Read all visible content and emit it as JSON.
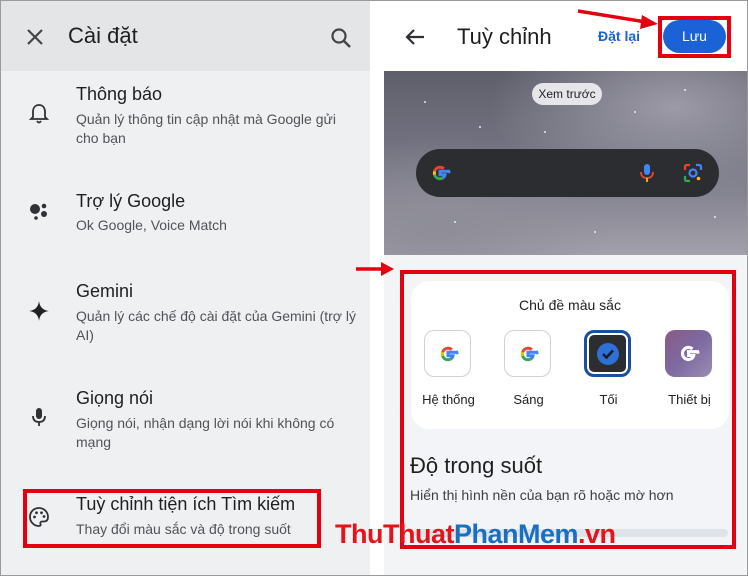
{
  "settings": {
    "title": "Cài đặt",
    "items": [
      {
        "icon": "bell-icon",
        "title": "Thông báo",
        "desc": "Quản lý thông tin cập nhật mà Google gửi cho bạn"
      },
      {
        "icon": "assistant-icon",
        "title": "Trợ lý Google",
        "desc": "Ok Google, Voice Match"
      },
      {
        "icon": "sparkle-icon",
        "title": "Gemini",
        "desc": "Quản lý các chế độ cài đặt của Gemini (trợ lý AI)"
      },
      {
        "icon": "microphone-icon",
        "title": "Giọng nói",
        "desc": "Giọng nói, nhận dạng lời nói khi không có mạng"
      },
      {
        "icon": "palette-icon",
        "title": "Tuỳ chỉnh tiện ích Tìm kiếm",
        "desc": "Thay đổi màu sắc và độ trong suốt"
      }
    ]
  },
  "customize": {
    "title": "Tuỳ chỉnh",
    "reset_label": "Đặt lại",
    "save_label": "Lưu",
    "preview_label": "Xem trước",
    "color_theme": {
      "title": "Chủ đề màu sắc",
      "options": [
        {
          "label": "Hệ thống",
          "selected": false
        },
        {
          "label": "Sáng",
          "selected": false
        },
        {
          "label": "Tối",
          "selected": true
        },
        {
          "label": "Thiết bị",
          "selected": false
        }
      ]
    },
    "transparency": {
      "title": "Độ trong suốt",
      "desc": "Hiển thị hình nền của bạn rõ hoặc mờ hơn"
    }
  },
  "watermark": {
    "part1": "ThuThuat",
    "part2": "PhanMem",
    "part3": ".vn"
  },
  "colors": {
    "accent": "#1a62d6",
    "highlight": "#e3000f"
  }
}
